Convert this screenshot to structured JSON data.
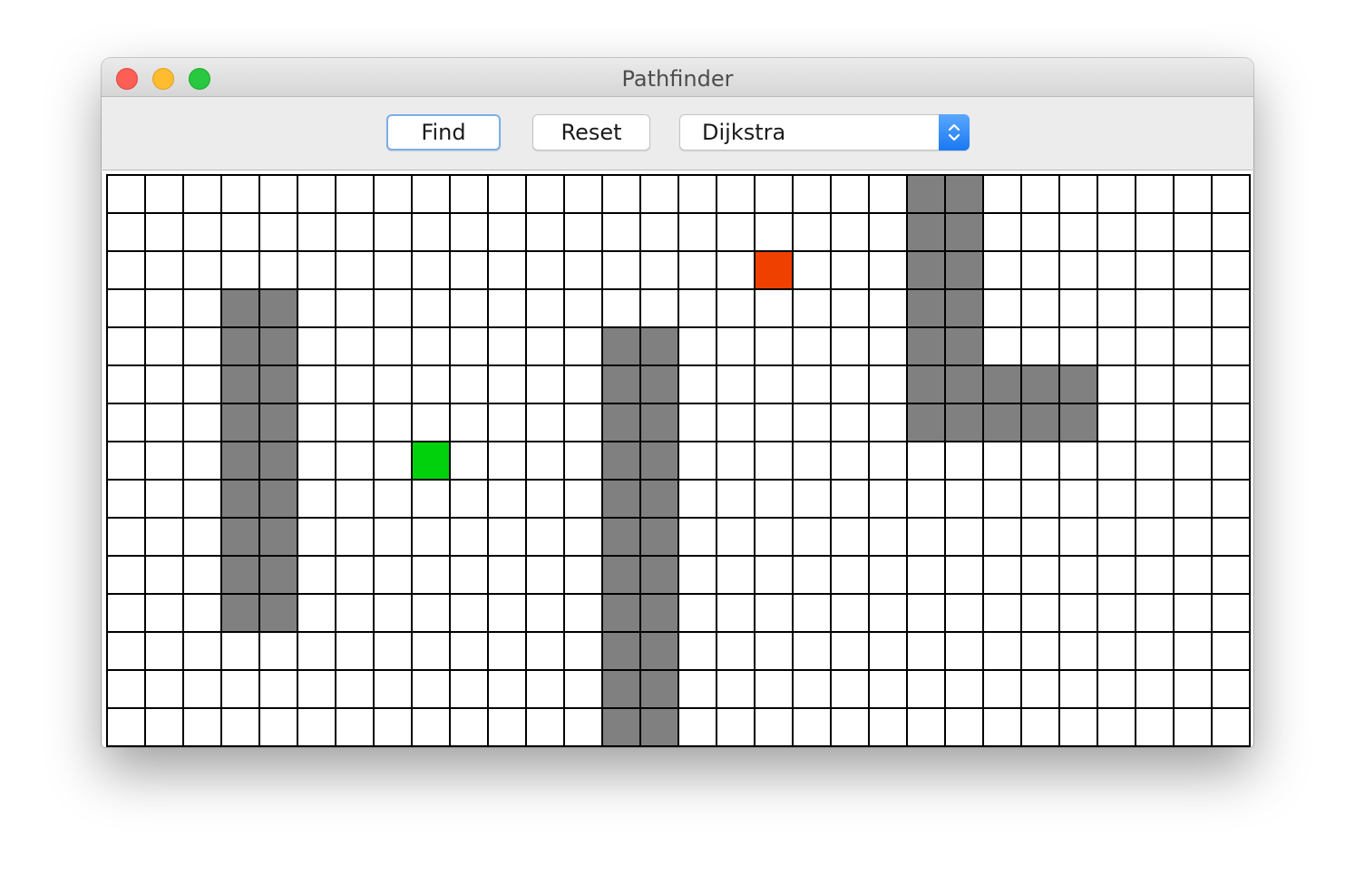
{
  "window": {
    "title": "Pathfinder"
  },
  "toolbar": {
    "find_label": "Find",
    "reset_label": "Reset",
    "algorithm": {
      "selected": "Dijkstra"
    }
  },
  "grid": {
    "cols": 30,
    "rows": 15,
    "colors": {
      "empty": "#ffffff",
      "wall": "#808080",
      "start": "#00d10c",
      "end": "#f04000",
      "line": "#000000"
    },
    "start": {
      "col": 8,
      "row": 7
    },
    "end": {
      "col": 17,
      "row": 2
    },
    "walls": [
      [
        3,
        3
      ],
      [
        4,
        3
      ],
      [
        3,
        4
      ],
      [
        4,
        4
      ],
      [
        3,
        5
      ],
      [
        4,
        5
      ],
      [
        3,
        6
      ],
      [
        4,
        6
      ],
      [
        3,
        7
      ],
      [
        4,
        7
      ],
      [
        3,
        8
      ],
      [
        4,
        8
      ],
      [
        3,
        9
      ],
      [
        4,
        9
      ],
      [
        3,
        10
      ],
      [
        4,
        10
      ],
      [
        3,
        11
      ],
      [
        4,
        11
      ],
      [
        13,
        4
      ],
      [
        14,
        4
      ],
      [
        13,
        5
      ],
      [
        14,
        5
      ],
      [
        13,
        6
      ],
      [
        14,
        6
      ],
      [
        13,
        7
      ],
      [
        14,
        7
      ],
      [
        13,
        8
      ],
      [
        14,
        8
      ],
      [
        13,
        9
      ],
      [
        14,
        9
      ],
      [
        13,
        10
      ],
      [
        14,
        10
      ],
      [
        13,
        11
      ],
      [
        14,
        11
      ],
      [
        13,
        12
      ],
      [
        14,
        12
      ],
      [
        13,
        13
      ],
      [
        14,
        13
      ],
      [
        13,
        14
      ],
      [
        14,
        14
      ],
      [
        21,
        0
      ],
      [
        22,
        0
      ],
      [
        21,
        1
      ],
      [
        22,
        1
      ],
      [
        21,
        2
      ],
      [
        22,
        2
      ],
      [
        21,
        3
      ],
      [
        22,
        3
      ],
      [
        21,
        4
      ],
      [
        22,
        4
      ],
      [
        21,
        5
      ],
      [
        22,
        5
      ],
      [
        21,
        6
      ],
      [
        22,
        6
      ],
      [
        23,
        5
      ],
      [
        24,
        5
      ],
      [
        25,
        5
      ],
      [
        23,
        6
      ],
      [
        24,
        6
      ],
      [
        25,
        6
      ]
    ]
  }
}
